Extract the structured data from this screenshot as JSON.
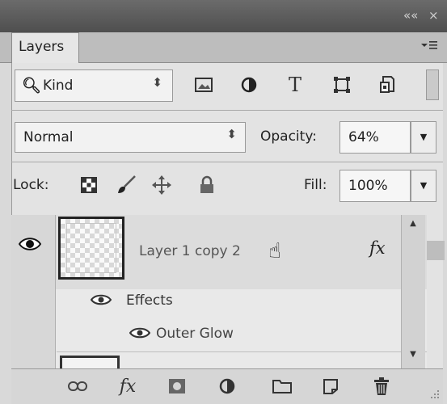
{
  "window": {
    "collapse_glyph": "««",
    "close_glyph": "×"
  },
  "panel": {
    "tab_label": "Layers",
    "menu_icon": "panel-menu-icon"
  },
  "filter": {
    "kind_label": "Kind",
    "icons": [
      "pixel-layer-filter-icon",
      "adjustment-layer-filter-icon",
      "type-layer-filter-icon",
      "shape-layer-filter-icon",
      "smart-object-filter-icon"
    ],
    "type_glyph": "T"
  },
  "blend": {
    "mode": "Normal",
    "opacity_label": "Opacity:",
    "opacity_value": "64%"
  },
  "lock": {
    "label": "Lock:",
    "icons": [
      "lock-transparent-pixels-icon",
      "lock-image-pixels-icon",
      "lock-position-icon",
      "lock-all-icon"
    ],
    "fill_label": "Fill:",
    "fill_value": "100%"
  },
  "layers": {
    "items": [
      {
        "name": "Layer 1 copy 2",
        "fx_badge": "fx",
        "effects_label": "Effects",
        "effects": [
          "Outer Glow"
        ]
      }
    ]
  },
  "toolbar": {
    "fx_label": "fx",
    "icons": [
      "link-layers-icon",
      "add-layer-style-icon",
      "add-mask-icon",
      "new-adjustment-layer-icon",
      "new-group-icon",
      "new-layer-icon",
      "delete-layer-icon"
    ]
  }
}
